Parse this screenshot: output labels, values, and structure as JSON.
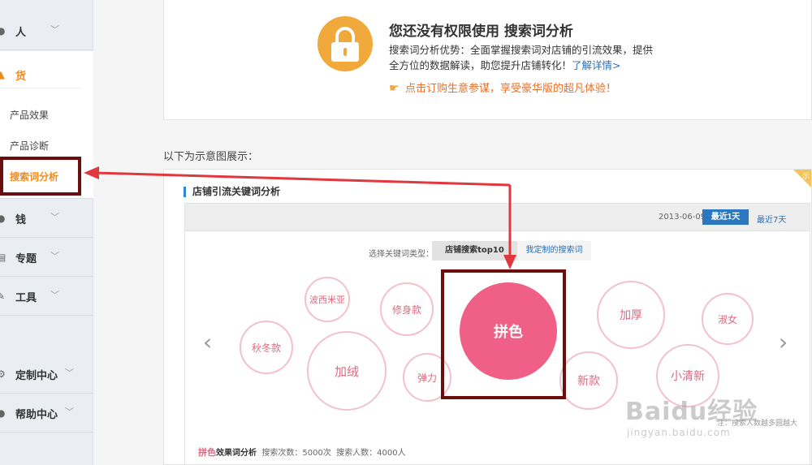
{
  "sidebar": {
    "groups": [
      {
        "label": "人",
        "icon": "person-icon"
      },
      {
        "label": "货",
        "icon": "goods-icon"
      },
      {
        "label": "钱",
        "icon": "money-icon"
      },
      {
        "label": "专题",
        "icon": "topic-icon"
      },
      {
        "label": "工具",
        "icon": "tool-icon"
      },
      {
        "label": "定制中心",
        "icon": "gear-icon"
      },
      {
        "label": "帮助中心",
        "icon": "help-icon"
      }
    ],
    "sub_items": [
      {
        "label": "产品效果"
      },
      {
        "label": "产品诊断"
      },
      {
        "label": "搜索词分析",
        "active": true
      }
    ]
  },
  "notice": {
    "title": "您还没有权限使用 搜索词分析",
    "desc_line1": "搜索词分析优势：全面掌握搜索词对店铺的引流效果，提供",
    "desc_line2": "全方位的数据解读，助您提升店铺转化！",
    "link": "了解详情>",
    "promo": "点击订购生意参谋，享受豪华版的超凡体验！"
  },
  "caption": "以下为示意图展示：",
  "preview": {
    "corner": "示",
    "section_title": "店铺引流关键词分析",
    "date": "2013-06-09",
    "btn_recent_1d": "最近1天",
    "btn_recent_7d": "最近7天",
    "keyword_type_label": "选择关键词类型：",
    "tab_top10": "店铺搜索top10",
    "tab_custom": "我定制的搜索词",
    "bubbles": [
      {
        "label": "秋冬款"
      },
      {
        "label": "波西米亚"
      },
      {
        "label": "加绒"
      },
      {
        "label": "修身款"
      },
      {
        "label": "弹力"
      },
      {
        "label": "拼色"
      },
      {
        "label": "新款"
      },
      {
        "label": "加厚"
      },
      {
        "label": "小清新"
      },
      {
        "label": "淑女"
      }
    ],
    "note": "注：搜索人数越多圆越大",
    "footer": {
      "keyword": "拼色",
      "title": "效果词分析",
      "search_count": "搜索次数：5000次",
      "search_users": "搜索人数：4000人"
    }
  },
  "watermark": {
    "logo": "Baidu经验",
    "domain": "jingyan.baidu.com"
  },
  "colors": {
    "accent_orange": "#ee8b1f",
    "highlight_box": "#6b0e0e",
    "arrow": "#e0383e",
    "main_bubble": "#f05f86",
    "primary_blue": "#2b77c0"
  }
}
